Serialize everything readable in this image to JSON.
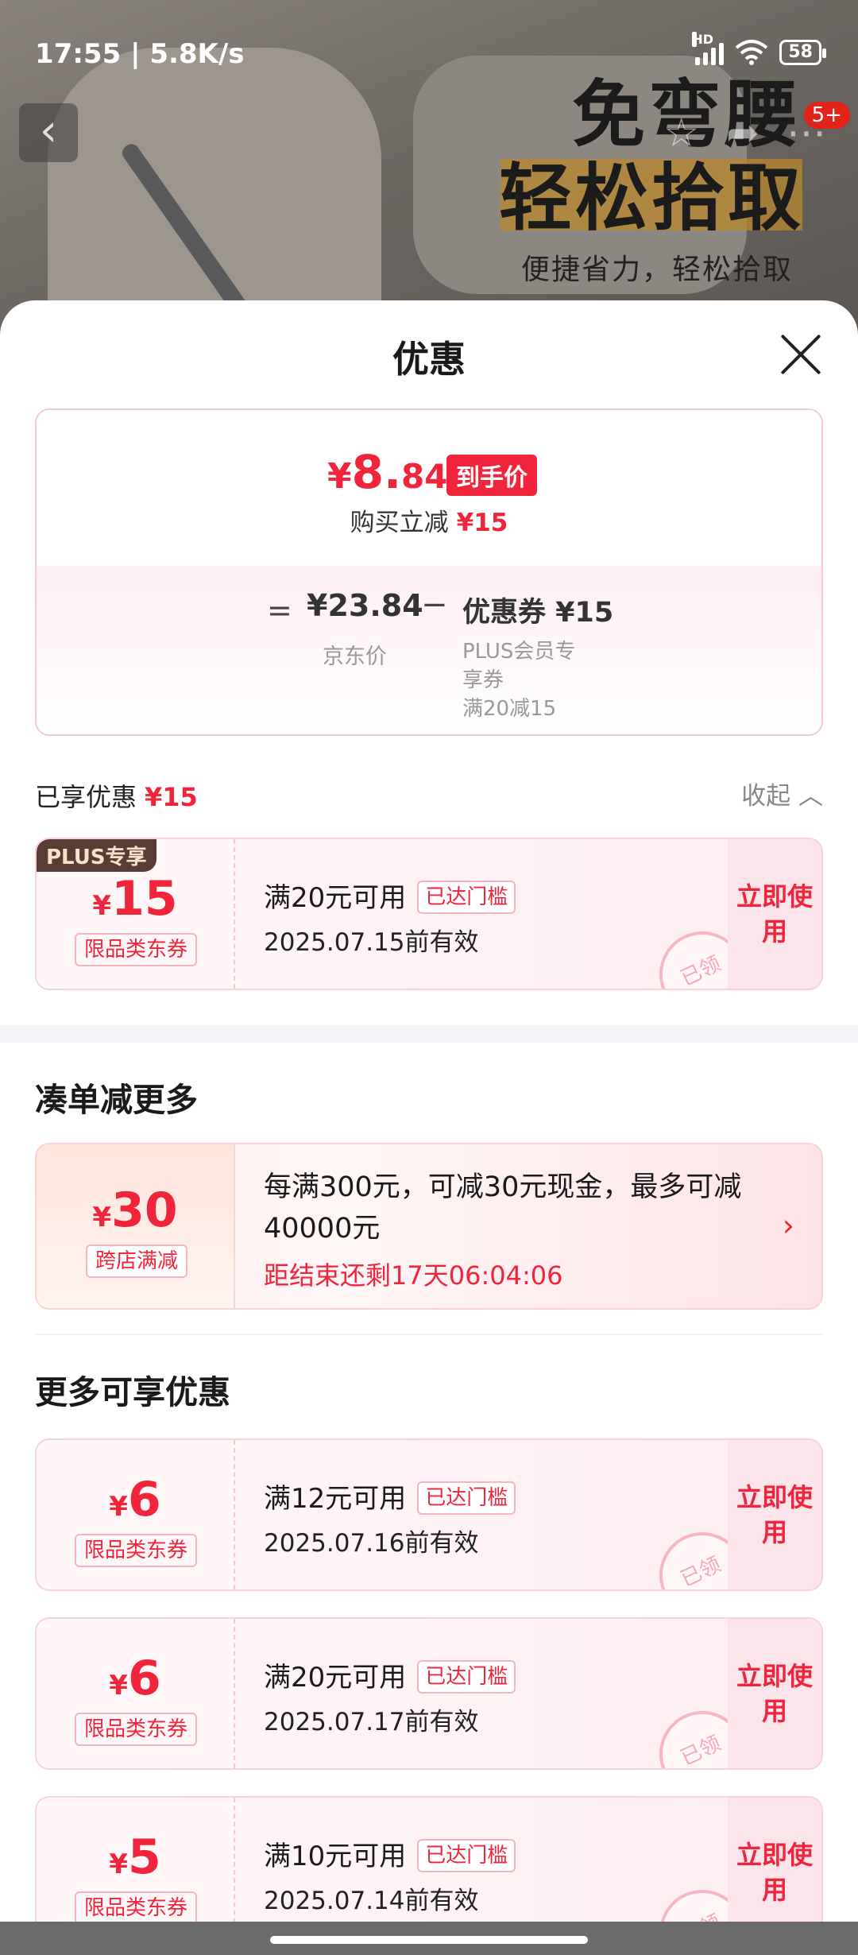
{
  "status": {
    "time_speed": "17:55 | 5.8K/s",
    "battery": "58",
    "hd": "HD"
  },
  "banner": {
    "line1": "免弯腰",
    "line2": "轻松拾取",
    "line3": "便捷省力，轻松拾取",
    "badge": "5+"
  },
  "sheet": {
    "title": "优惠"
  },
  "price": {
    "final_yen": "¥",
    "final_int": "8.",
    "final_dec": "84",
    "final_tag": "到手价",
    "reduce_label": "购买立减",
    "reduce_amount": "¥15",
    "eq": "=",
    "jd_price": "¥23.84",
    "jd_label": "京东价",
    "minus": "−",
    "coupon_price": "优惠券 ¥15",
    "coupon_desc_1": "PLUS会员专享券",
    "coupon_desc_2": "满20减15"
  },
  "enjoyed": {
    "label": "已享优惠",
    "amount": "¥15",
    "collapse": "收起 ︿"
  },
  "coupons": [
    {
      "tag": "PLUS专享",
      "yen": "¥",
      "value": "15",
      "type": "限品类东券",
      "condition": "满20元可用",
      "threshold": "已达门槛",
      "expiry": "2025.07.15前有效",
      "use": "立即使用",
      "stamp": "已领"
    },
    {
      "yen": "¥",
      "value": "6",
      "type": "限品类东券",
      "condition": "满12元可用",
      "threshold": "已达门槛",
      "expiry": "2025.07.16前有效",
      "use": "立即使用",
      "stamp": "已领"
    },
    {
      "yen": "¥",
      "value": "6",
      "type": "限品类东券",
      "condition": "满20元可用",
      "threshold": "已达门槛",
      "expiry": "2025.07.17前有效",
      "use": "立即使用",
      "stamp": "已领"
    },
    {
      "yen": "¥",
      "value": "5",
      "type": "限品类东券",
      "condition": "满10元可用",
      "threshold": "已达门槛",
      "expiry": "2025.07.14前有效",
      "use": "立即使用",
      "stamp": "已领"
    }
  ],
  "section_more_orders": {
    "title": "凑单减更多"
  },
  "promo": {
    "yen": "¥",
    "value": "30",
    "type": "跨店满减",
    "desc": "每满300元，可减30元现金，最多可减40000元",
    "countdown": "距结束还剩17天06:04:06",
    "chevron": "›"
  },
  "section_more_offers": {
    "title": "更多可享优惠"
  },
  "colors": {
    "accent": "#f0253c",
    "tag_bg": "#5a3c34"
  }
}
